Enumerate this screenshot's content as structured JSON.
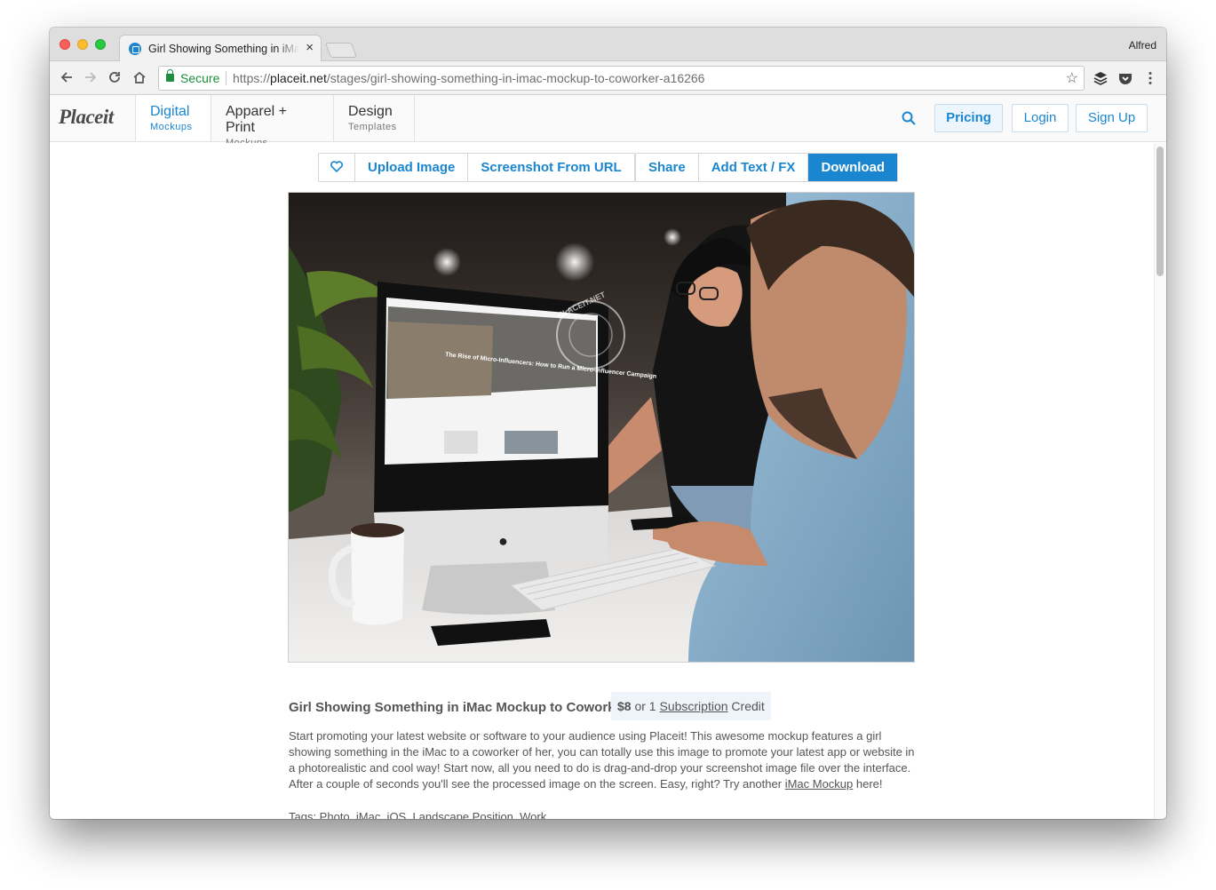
{
  "browser": {
    "tab_title": "Girl Showing Something in iMac Mockup to Coworker",
    "profile_name": "Alfred",
    "secure_label": "Secure",
    "url_scheme": "https://",
    "url_host": "placeit.net",
    "url_path": "/stages/girl-showing-something-in-imac-mockup-to-coworker-a16266"
  },
  "site": {
    "logo": "Placeit",
    "nav": [
      {
        "label": "Digital",
        "sub": "Mockups"
      },
      {
        "label": "Apparel + Print",
        "sub": "Mockups"
      },
      {
        "label": "Design",
        "sub": "Templates"
      }
    ],
    "pricing": "Pricing",
    "login": "Login",
    "signup": "Sign Up"
  },
  "toolbar": {
    "upload": "Upload Image",
    "screenshot": "Screenshot From URL",
    "share": "Share",
    "add_text": "Add Text / FX",
    "download": "Download"
  },
  "mockup": {
    "screen_headline": "The Rise of Micro-Influencers: How to Run a Micro-Influencer Campaign",
    "watermark": "PLACEIT.NET"
  },
  "product": {
    "title": "Girl Showing Something in iMac Mockup to Coworker",
    "price": "$8",
    "price_or": "or 1",
    "subscription_link": "Subscription",
    "credit": "Credit",
    "description_a": "Start promoting your latest website or software to your audience using Placeit! This awesome mockup features a girl showing something in the iMac to a coworker of her, you can totally use this image to promote your latest app or website in a photorealistic and cool way! Start now, all you need to do is drag-and-drop your screenshot image file over the interface. After a couple of seconds you'll see the processed image on the screen. Easy, right? Try another",
    "description_link": "iMac Mockup",
    "description_b": "here!",
    "tags": "Tags: Photo, iMac, iOS, Landscape Position, Work"
  },
  "colors": {
    "accent": "#1a86d0",
    "secure": "#1e8e3e"
  }
}
